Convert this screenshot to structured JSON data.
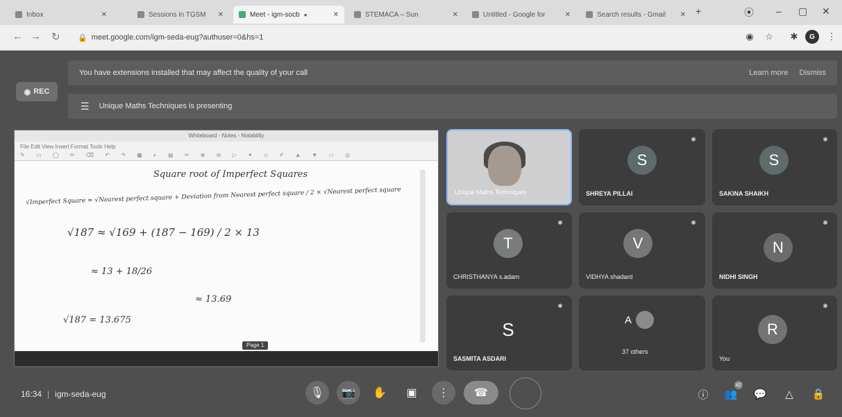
{
  "browser": {
    "tabs": [
      {
        "label": "Inbox",
        "active": false
      },
      {
        "label": "Sessions in TGSM",
        "active": false
      },
      {
        "label": "Meet - igm-socb",
        "active": true
      },
      {
        "label": "STEMACA – Sun",
        "active": false
      },
      {
        "label": "Untitled - Google for",
        "active": false
      },
      {
        "label": "Search results - Gmail",
        "active": false
      }
    ],
    "new_tab": "+",
    "url": "meet.google.com/igm-seda-eug?authuser=0&hs=1",
    "window_controls": {
      "minimize": "–",
      "maximize": "▢",
      "close": "✕"
    }
  },
  "meet": {
    "rec_label": "REC",
    "extension_banner": {
      "text": "You have extensions installed that may affect the quality of your call",
      "learn_more": "Learn more",
      "dismiss": "Dismiss"
    },
    "presenting_banner": {
      "text": "Unique Maths Techniques is presenting"
    },
    "presentation": {
      "window_title": "Whiteboard - Notes - Notability",
      "toolbar_text": "File   Edit   View   Insert   Format   Tools   Help",
      "heading": "Square root of Imperfect Squares",
      "lines": [
        "√Imperfect Square ≈ √Nearest perfect square + Deviation from Nearest perfect square / 2 × √Nearest perfect square",
        "√187 ≈ √169 + (187 − 169) / 2 × 13",
        "≈ 13 + 18/26",
        "≈ 13.69",
        "√187 = 13.675"
      ],
      "page_chip": "Page 1"
    },
    "participants": [
      {
        "name": "Unique Maths Techniques",
        "initial": "",
        "type": "camera"
      },
      {
        "name": "SHREYA PILLAI",
        "initial": "S"
      },
      {
        "name": "SAKINA SHAIKH",
        "initial": "S"
      },
      {
        "name": "CHRISTHANYA s.adam",
        "initial": "T"
      },
      {
        "name": "VIDHYA shadard",
        "initial": "V"
      },
      {
        "name": "NIDHI SINGH",
        "initial": "N"
      },
      {
        "name": "SASMITA ASDARI",
        "initial": "S"
      },
      {
        "name": "37 others",
        "initial": "A"
      },
      {
        "name": "You",
        "initial": "R"
      }
    ],
    "meeting_time": "16:34",
    "meeting_code": "igm-seda-eug",
    "separator": "|",
    "controls": {
      "mic": "🎙",
      "camera": "📷",
      "raise_hand": "✋",
      "present": "▣",
      "more": "⋮",
      "end_call": "☎"
    },
    "right_controls": {
      "info": "ⓘ",
      "people": "👥",
      "people_count": "42",
      "chat": "💬",
      "activities": "△",
      "host_controls": "🔒"
    },
    "colors": {
      "avatar_s": "#5f6a6a",
      "avatar_t": "#7a7b7b",
      "avatar_v": "#777777",
      "avatar_n": "#6b6b6b",
      "avatar_r": "#737373",
      "avatar_a_small": "#8a8a8a"
    }
  }
}
